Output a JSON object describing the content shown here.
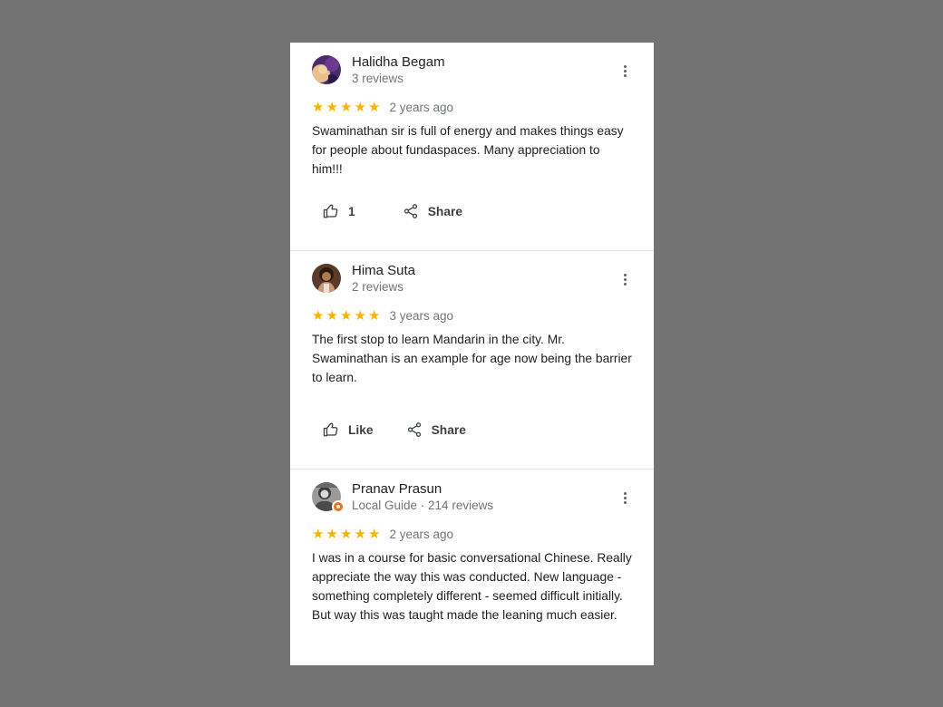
{
  "reviews": [
    {
      "name": "Halidha Begam",
      "subtitle": "3 reviews",
      "stars": 5,
      "age": "2 years ago",
      "text": "Swaminathan sir is full of energy and makes things easy for people about fundaspaces. Many appreciation to him!!!",
      "like_label": "1",
      "share_label": "Share"
    },
    {
      "name": "Hima Suta",
      "subtitle": "2 reviews",
      "stars": 5,
      "age": "3 years ago",
      "text": "The first stop to learn Mandarin in the city. Mr. Swaminathan is an example for age now being the barrier to learn.",
      "like_label": "Like",
      "share_label": "Share"
    },
    {
      "name": "Pranav Prasun",
      "subtitle": "Local Guide · 214 reviews",
      "stars": 5,
      "age": "2 years ago",
      "text": "I was in a course for basic conversational Chinese. Really appreciate the way this was conducted. New language - something completely different - seemed difficult initially. But way this was taught made the leaning much easier."
    }
  ],
  "icons": {
    "like": "thumbs-up-icon",
    "share": "share-icon",
    "more": "more-vert-icon",
    "star": "star-icon"
  },
  "colors": {
    "star": "#f4b400",
    "background": "#737373",
    "card": "#ffffff",
    "local_guide_badge": "#e8711b"
  }
}
